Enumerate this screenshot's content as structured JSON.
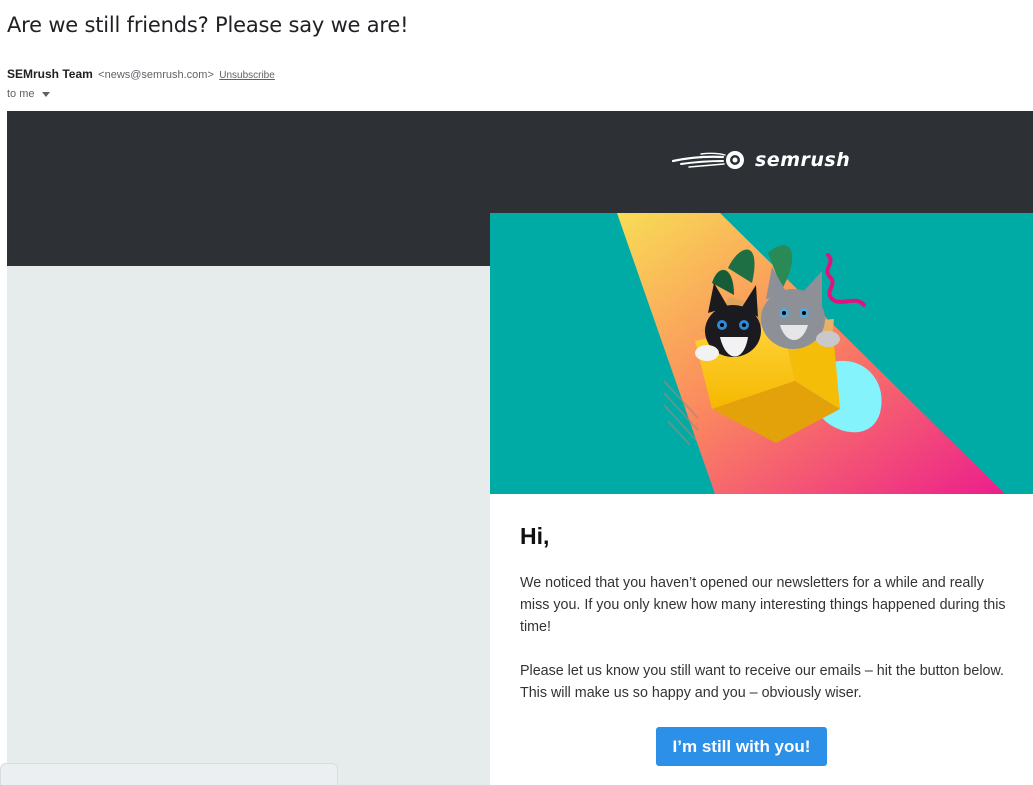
{
  "email": {
    "subject": "Are we still friends? Please say we are!",
    "sender_name": "SEMrush Team",
    "sender_email": "<news@semrush.com>",
    "unsubscribe_label": "Unsubscribe",
    "recipient_label": "to me"
  },
  "newsletter": {
    "logo_text": "semrush",
    "greeting": "Hi,",
    "paragraph_1": "We noticed that you haven’t opened our newsletters for a while and really miss you. If you only knew how many interesting things happened during this time!",
    "paragraph_2": "Please let us know you still want to receive our emails – hit the button below. This will make us so happy and you – obviously wiser.",
    "cta_label": "I’m still with you!"
  },
  "colors": {
    "header_dark": "#2d3136",
    "page_bg": "#e6ecec",
    "hero_teal": "#00aba5",
    "cta_blue": "#2c8fe8"
  },
  "icons": {
    "logo_mark": "semrush-fireball-icon",
    "recipient_toggle": "chevron-down-icon"
  }
}
